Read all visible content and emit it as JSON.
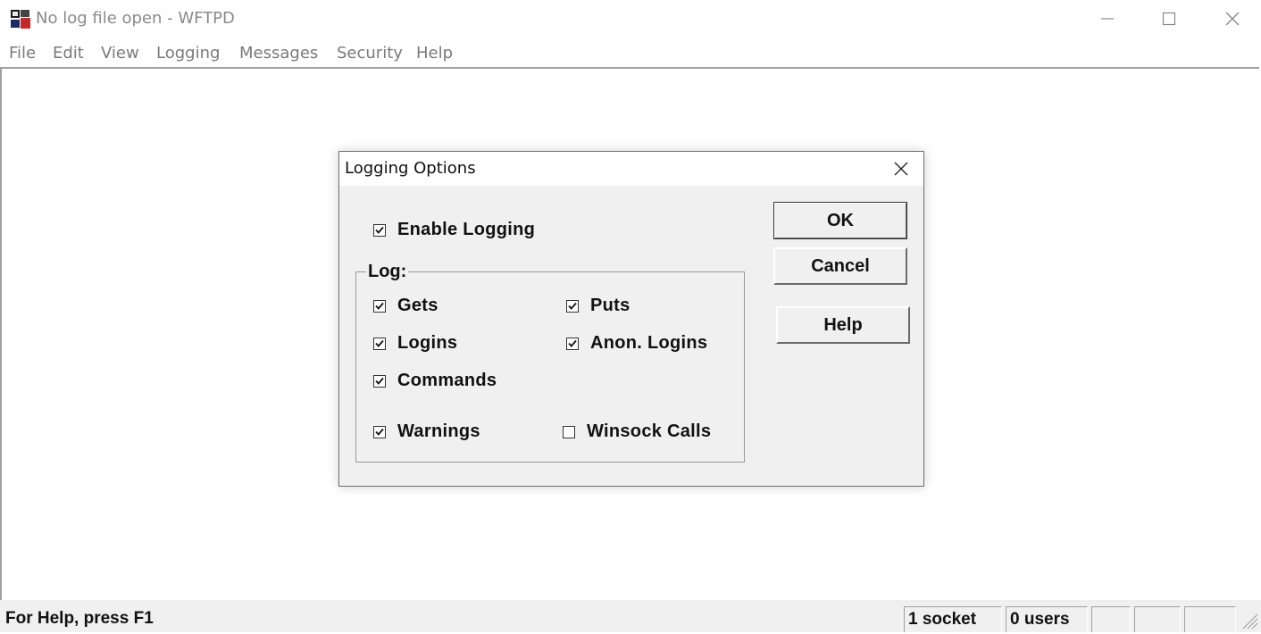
{
  "window": {
    "title": "No log file open - WFTPD",
    "icon": "wftpd-app-icon"
  },
  "menu": [
    "File",
    "Edit",
    "View",
    "Logging",
    "Messages",
    "Security",
    "Help"
  ],
  "dialog": {
    "title": "Logging Options",
    "enable_logging": {
      "label": "Enable Logging",
      "checked": true
    },
    "group_label": "Log:",
    "options": {
      "gets": {
        "label": "Gets",
        "checked": true
      },
      "puts": {
        "label": "Puts",
        "checked": true
      },
      "logins": {
        "label": "Logins",
        "checked": true
      },
      "anon_logins": {
        "label": "Anon. Logins",
        "checked": true
      },
      "commands": {
        "label": "Commands",
        "checked": true
      },
      "warnings": {
        "label": "Warnings",
        "checked": true
      },
      "winsock_calls": {
        "label": "Winsock Calls",
        "checked": false
      }
    },
    "buttons": {
      "ok": "OK",
      "cancel": "Cancel",
      "help": "Help"
    }
  },
  "statusbar": {
    "help_text": "For Help, press F1",
    "sockets": "1 socket",
    "users": "0 users"
  },
  "colors": {
    "dialog_bg": "#f0f0f0",
    "title_text_inactive": "#8a8a8a"
  }
}
